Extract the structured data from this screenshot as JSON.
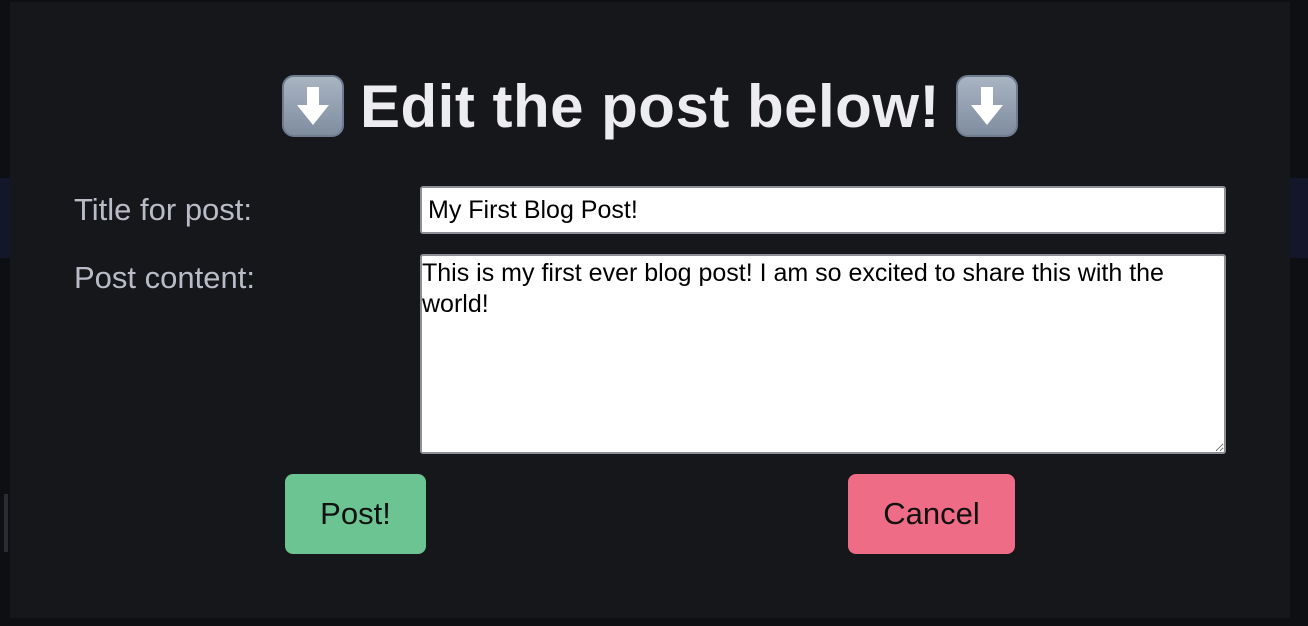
{
  "dialog": {
    "heading": "Edit the post below!",
    "heading_icon_left": "down-arrow-emoji",
    "heading_icon_right": "down-arrow-emoji"
  },
  "form": {
    "title_label": "Title for post:",
    "title_value": "My First Blog Post!",
    "content_label": "Post content:",
    "content_value": "This is my first ever blog post! I am so excited to share this with the world!"
  },
  "actions": {
    "post_label": "Post!",
    "cancel_label": "Cancel"
  },
  "colors": {
    "background": "#16171b",
    "post_button": "#6cc492",
    "cancel_button": "#ee6c85",
    "heading_text": "#ececf1",
    "label_text": "#b9bcc6"
  }
}
